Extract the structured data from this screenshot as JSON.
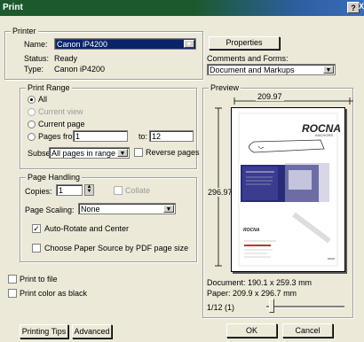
{
  "window": {
    "title": "Print",
    "help_btn": "?",
    "close_btn": "X"
  },
  "printer": {
    "group_label": "Printer",
    "name_label": "Name:",
    "name_value": "Canon iP4200",
    "status_label": "Status:",
    "status_value": "Ready",
    "type_label": "Type:",
    "type_value": "Canon iP4200",
    "properties_btn": "Properties",
    "comments_forms_label": "Comments and Forms:",
    "comments_forms_value": "Document and Markups"
  },
  "print_range": {
    "group_label": "Print Range",
    "all_label": "All",
    "current_view_label": "Current view",
    "current_page_label": "Current page",
    "pages_from_label": "Pages from:",
    "pages_from_value": "1",
    "to_label": "to:",
    "to_value": "12",
    "subset_label": "Subset:",
    "subset_value": "All pages in range",
    "reverse_label": "Reverse pages"
  },
  "page_handling": {
    "group_label": "Page Handling",
    "copies_label": "Copies:",
    "copies_value": "1",
    "collate_label": "Collate",
    "scaling_label": "Page Scaling:",
    "scaling_value": "None",
    "auto_rotate_label": "Auto-Rotate and Center",
    "paper_source_label": "Choose Paper Source by PDF page size"
  },
  "options": {
    "print_to_file_label": "Print to file",
    "print_color_black_label": "Print color as black"
  },
  "preview": {
    "group_label": "Preview",
    "width_dim": "209.97",
    "height_dim": "296.97",
    "document_size": "Document: 190.1 x 259.3 mm",
    "paper_size": "Paper: 209.9 x 296.7 mm",
    "page_indicator": "1/12 (1)",
    "logo_text": "ROCNA",
    "logo_sub": "ANCHORS",
    "small_logo": "ROCNA"
  },
  "buttons": {
    "printing_tips": "Printing Tips",
    "advanced": "Advanced",
    "ok": "OK",
    "cancel": "Cancel"
  }
}
